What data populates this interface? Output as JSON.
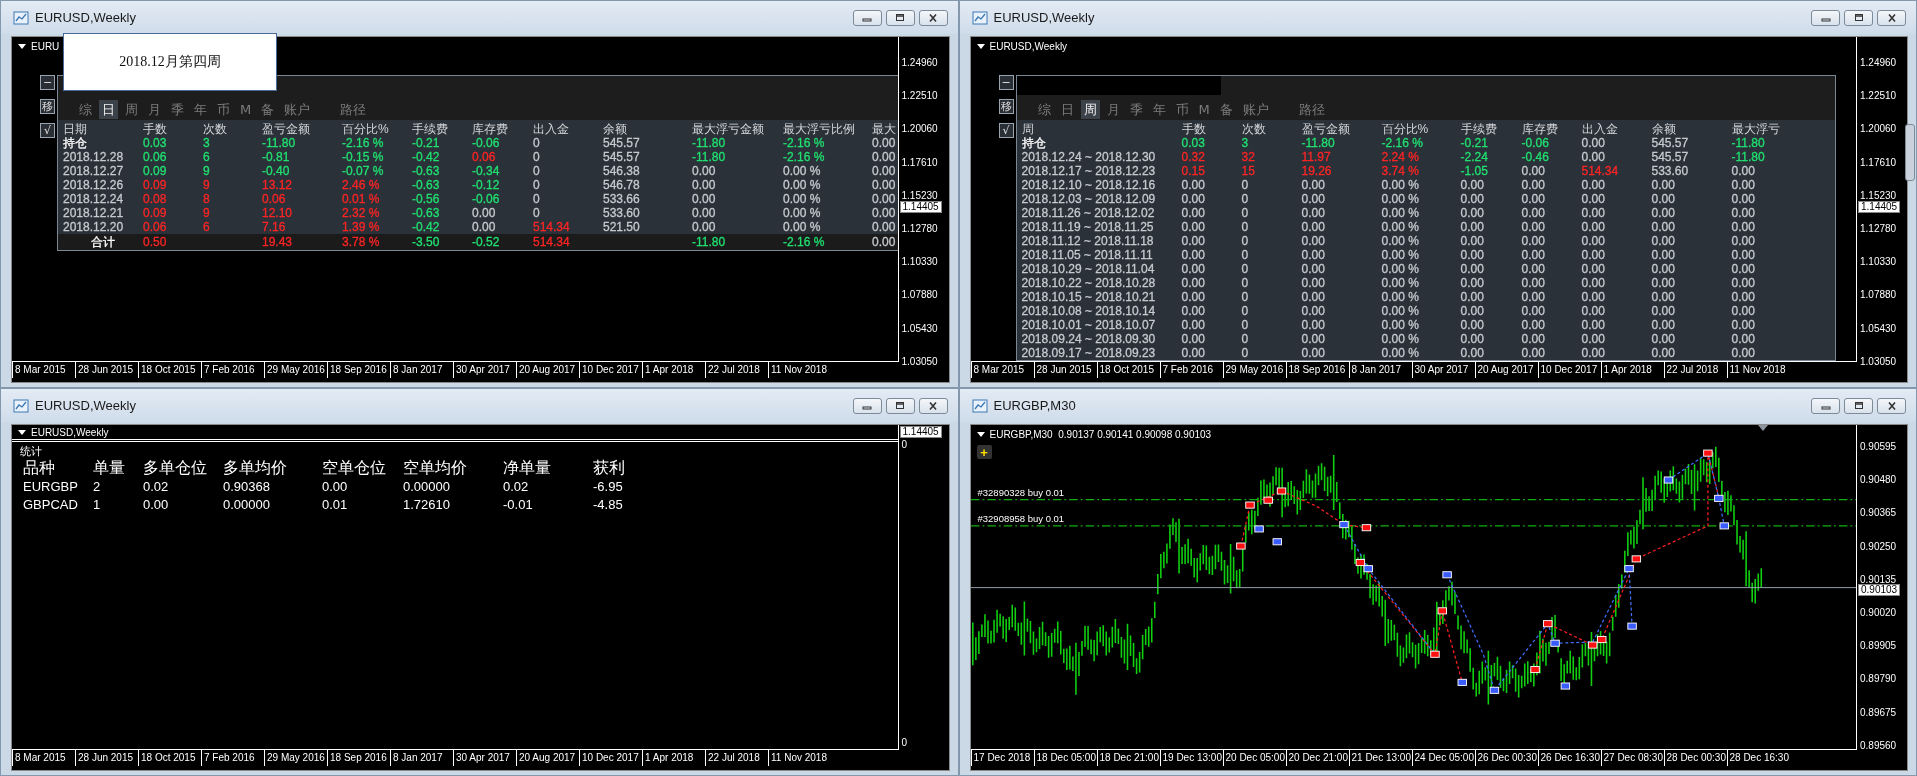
{
  "windows": [
    {
      "title": "EURUSD,Weekly",
      "popup": {
        "text": "2018.12月第四周"
      },
      "chart": {
        "header": "EURU",
        "price_axis": [
          "1.24960",
          "1.22510",
          "1.20060",
          "1.17610",
          "1.15230",
          "1.12780",
          "1.10330",
          "1.07880",
          "1.05430",
          "1.03050"
        ],
        "current_price": "1.14405",
        "time_axis": [
          "8 Mar 2015",
          "28 Jun 2015",
          "18 Oct 2015",
          "7 Feb 2016",
          "29 May 2016",
          "18 Sep 2016",
          "8 Jan 2017",
          "30 Apr 2017",
          "20 Aug 2017",
          "10 Dec 2017",
          "1 Apr 2018",
          "22 Jul 2018",
          "11 Nov 2018"
        ]
      },
      "panel": {
        "kind": "report",
        "redacted": false,
        "side_buttons": [
          "−",
          "移",
          "√"
        ],
        "tabs": [
          {
            "label": "综",
            "selected": false
          },
          {
            "label": "日",
            "selected": true
          },
          {
            "label": "周",
            "selected": false
          },
          {
            "label": "月",
            "selected": false
          },
          {
            "label": "季",
            "selected": false
          },
          {
            "label": "年",
            "selected": false
          },
          {
            "label": "币",
            "selected": false
          },
          {
            "label": "M",
            "selected": false
          },
          {
            "label": "备",
            "selected": false
          },
          {
            "label": "账户",
            "selected": false
          },
          {
            "label": "路径",
            "selected": false
          }
        ],
        "columns": [
          "日期",
          "手数",
          "次数",
          "盈亏金额",
          "百分比%",
          "手续费",
          "库存费",
          "出入金",
          "余额",
          "最大浮亏金额",
          "最大浮亏比例",
          "最大"
        ],
        "rows": [
          {
            "kind": "data",
            "cells": [
              {
                "text": "持仓",
                "color": "#ffffff"
              },
              {
                "text": "0.03",
                "color": "#20e070"
              },
              {
                "text": "3",
                "color": "#20e070"
              },
              {
                "text": "-11.80",
                "color": "#20e070"
              },
              {
                "text": "-2.16 %",
                "color": "#20e070"
              },
              {
                "text": "-0.21",
                "color": "#20e070"
              },
              {
                "text": "-0.06",
                "color": "#20e070"
              },
              {
                "text": "0",
                "color": "#c6cad0"
              },
              {
                "text": "545.57",
                "color": "#c6cad0"
              },
              {
                "text": "-11.80",
                "color": "#20e070"
              },
              {
                "text": "-2.16 %",
                "color": "#20e070"
              },
              {
                "text": "0.00",
                "color": "#c6cad0"
              }
            ]
          },
          {
            "kind": "data",
            "cells": [
              {
                "text": "2018.12.28",
                "color": "#c6cad0"
              },
              {
                "text": "0.06",
                "color": "#20e070"
              },
              {
                "text": "6",
                "color": "#20e070"
              },
              {
                "text": "-0.81",
                "color": "#20e070"
              },
              {
                "text": "-0.15 %",
                "color": "#20e070"
              },
              {
                "text": "-0.42",
                "color": "#20e070"
              },
              {
                "text": "0.06",
                "color": "#ff2424"
              },
              {
                "text": "0",
                "color": "#c6cad0"
              },
              {
                "text": "545.57",
                "color": "#c6cad0"
              },
              {
                "text": "-11.80",
                "color": "#20e070"
              },
              {
                "text": "-2.16 %",
                "color": "#20e070"
              },
              {
                "text": "0.00",
                "color": "#c6cad0"
              }
            ]
          },
          {
            "kind": "data",
            "cells": [
              {
                "text": "2018.12.27",
                "color": "#c6cad0"
              },
              {
                "text": "0.09",
                "color": "#20e070"
              },
              {
                "text": "9",
                "color": "#20e070"
              },
              {
                "text": "-0.40",
                "color": "#20e070"
              },
              {
                "text": "-0.07 %",
                "color": "#20e070"
              },
              {
                "text": "-0.63",
                "color": "#20e070"
              },
              {
                "text": "-0.34",
                "color": "#20e070"
              },
              {
                "text": "0",
                "color": "#c6cad0"
              },
              {
                "text": "546.38",
                "color": "#c6cad0"
              },
              {
                "text": "0.00",
                "color": "#c6cad0"
              },
              {
                "text": "0.00 %",
                "color": "#c6cad0"
              },
              {
                "text": "0.00",
                "color": "#c6cad0"
              }
            ]
          },
          {
            "kind": "data",
            "cells": [
              {
                "text": "2018.12.26",
                "color": "#c6cad0"
              },
              {
                "text": "0.09",
                "color": "#ff2424"
              },
              {
                "text": "9",
                "color": "#ff2424"
              },
              {
                "text": "13.12",
                "color": "#ff2424"
              },
              {
                "text": "2.46 %",
                "color": "#ff2424"
              },
              {
                "text": "-0.63",
                "color": "#20e070"
              },
              {
                "text": "-0.12",
                "color": "#20e070"
              },
              {
                "text": "0",
                "color": "#c6cad0"
              },
              {
                "text": "546.78",
                "color": "#c6cad0"
              },
              {
                "text": "0.00",
                "color": "#c6cad0"
              },
              {
                "text": "0.00 %",
                "color": "#c6cad0"
              },
              {
                "text": "0.00",
                "color": "#c6cad0"
              }
            ]
          },
          {
            "kind": "data",
            "cells": [
              {
                "text": "2018.12.24",
                "color": "#c6cad0"
              },
              {
                "text": "0.08",
                "color": "#ff2424"
              },
              {
                "text": "8",
                "color": "#ff2424"
              },
              {
                "text": "0.06",
                "color": "#ff2424"
              },
              {
                "text": "0.01 %",
                "color": "#ff2424"
              },
              {
                "text": "-0.56",
                "color": "#20e070"
              },
              {
                "text": "-0.06",
                "color": "#20e070"
              },
              {
                "text": "0",
                "color": "#c6cad0"
              },
              {
                "text": "533.66",
                "color": "#c6cad0"
              },
              {
                "text": "0.00",
                "color": "#c6cad0"
              },
              {
                "text": "0.00 %",
                "color": "#c6cad0"
              },
              {
                "text": "0.00",
                "color": "#c6cad0"
              }
            ]
          },
          {
            "kind": "data",
            "cells": [
              {
                "text": "2018.12.21",
                "color": "#c6cad0"
              },
              {
                "text": "0.09",
                "color": "#ff2424"
              },
              {
                "text": "9",
                "color": "#ff2424"
              },
              {
                "text": "12.10",
                "color": "#ff2424"
              },
              {
                "text": "2.32 %",
                "color": "#ff2424"
              },
              {
                "text": "-0.63",
                "color": "#20e070"
              },
              {
                "text": "0.00",
                "color": "#c6cad0"
              },
              {
                "text": "0",
                "color": "#c6cad0"
              },
              {
                "text": "533.60",
                "color": "#c6cad0"
              },
              {
                "text": "0.00",
                "color": "#c6cad0"
              },
              {
                "text": "0.00 %",
                "color": "#c6cad0"
              },
              {
                "text": "0.00",
                "color": "#c6cad0"
              }
            ]
          },
          {
            "kind": "data",
            "cells": [
              {
                "text": "2018.12.20",
                "color": "#c6cad0"
              },
              {
                "text": "0.06",
                "color": "#ff2424"
              },
              {
                "text": "6",
                "color": "#ff2424"
              },
              {
                "text": "7.16",
                "color": "#ff2424"
              },
              {
                "text": "1.39 %",
                "color": "#ff2424"
              },
              {
                "text": "-0.42",
                "color": "#20e070"
              },
              {
                "text": "0.00",
                "color": "#c6cad0"
              },
              {
                "text": "514.34",
                "color": "#ff2424"
              },
              {
                "text": "521.50",
                "color": "#c6cad0"
              },
              {
                "text": "0.00",
                "color": "#c6cad0"
              },
              {
                "text": "0.00 %",
                "color": "#c6cad0"
              },
              {
                "text": "0.00",
                "color": "#c6cad0"
              }
            ]
          },
          {
            "kind": "total",
            "cells": [
              {
                "text": "合计",
                "color": "#ffffff"
              },
              {
                "text": "0.50",
                "color": "#ff2424"
              },
              null,
              {
                "text": "19.43",
                "color": "#ff2424"
              },
              {
                "text": "3.78 %",
                "color": "#ff2424"
              },
              {
                "text": "-3.50",
                "color": "#20e070"
              },
              {
                "text": "-0.52",
                "color": "#20e070"
              },
              {
                "text": "514.34",
                "color": "#ff2424"
              },
              null,
              {
                "text": "-11.80",
                "color": "#20e070"
              },
              {
                "text": "-2.16 %",
                "color": "#20e070"
              },
              {
                "text": "0.00",
                "color": "#c6cad0"
              }
            ]
          }
        ]
      }
    },
    {
      "title": "EURUSD,Weekly",
      "chart": {
        "header": "EURUSD,Weekly",
        "price_axis": [
          "1.24960",
          "1.22510",
          "1.20060",
          "1.17610",
          "1.15230",
          "1.12780",
          "1.10330",
          "1.07880",
          "1.05430",
          "1.03050"
        ],
        "current_price": "1.14405",
        "time_axis": [
          "8 Mar 2015",
          "28 Jun 2015",
          "18 Oct 2015",
          "7 Feb 2016",
          "29 May 2016",
          "18 Sep 2016",
          "8 Jan 2017",
          "30 Apr 2017",
          "20 Aug 2017",
          "10 Dec 2017",
          "1 Apr 2018",
          "22 Jul 2018",
          "11 Nov 2018"
        ]
      },
      "panel": {
        "kind": "report",
        "redacted": true,
        "side_buttons": [
          "−",
          "移",
          "√"
        ],
        "tabs": [
          {
            "label": "综",
            "selected": false
          },
          {
            "label": "日",
            "selected": false
          },
          {
            "label": "周",
            "selected": true
          },
          {
            "label": "月",
            "selected": false
          },
          {
            "label": "季",
            "selected": false
          },
          {
            "label": "年",
            "selected": false
          },
          {
            "label": "币",
            "selected": false
          },
          {
            "label": "M",
            "selected": false
          },
          {
            "label": "备",
            "selected": false
          },
          {
            "label": "账户",
            "selected": false
          },
          {
            "label": "路径",
            "selected": false
          }
        ],
        "columns": [
          "周",
          "手数",
          "次数",
          "盈亏金额",
          "百分比%",
          "手续费",
          "库存费",
          "出入金",
          "余额",
          "最大浮亏"
        ],
        "rows": [
          {
            "kind": "data",
            "cells": [
              {
                "text": "持仓",
                "color": "#ffffff"
              },
              {
                "text": "0.03",
                "color": "#20e070"
              },
              {
                "text": "3",
                "color": "#20e070"
              },
              {
                "text": "-11.80",
                "color": "#20e070"
              },
              {
                "text": "-2.16 %",
                "color": "#20e070"
              },
              {
                "text": "-0.21",
                "color": "#20e070"
              },
              {
                "text": "-0.06",
                "color": "#20e070"
              },
              {
                "text": "0.00",
                "color": "#c6cad0"
              },
              {
                "text": "545.57",
                "color": "#c6cad0"
              },
              {
                "text": "-11.80",
                "color": "#20e070"
              }
            ]
          },
          {
            "kind": "data",
            "cells": [
              {
                "text": "2018.12.24 ~ 2018.12.30",
                "color": "#c6cad0"
              },
              {
                "text": "0.32",
                "color": "#ff2424"
              },
              {
                "text": "32",
                "color": "#ff2424"
              },
              {
                "text": "11.97",
                "color": "#ff2424"
              },
              {
                "text": "2.24 %",
                "color": "#ff2424"
              },
              {
                "text": "-2.24",
                "color": "#20e070"
              },
              {
                "text": "-0.46",
                "color": "#20e070"
              },
              {
                "text": "0.00",
                "color": "#c6cad0"
              },
              {
                "text": "545.57",
                "color": "#c6cad0"
              },
              {
                "text": "-11.80",
                "color": "#20e070"
              }
            ]
          },
          {
            "kind": "data",
            "cells": [
              {
                "text": "2018.12.17 ~ 2018.12.23",
                "color": "#c6cad0"
              },
              {
                "text": "0.15",
                "color": "#ff2424"
              },
              {
                "text": "15",
                "color": "#ff2424"
              },
              {
                "text": "19.26",
                "color": "#ff2424"
              },
              {
                "text": "3.74 %",
                "color": "#ff2424"
              },
              {
                "text": "-1.05",
                "color": "#20e070"
              },
              {
                "text": "0.00",
                "color": "#c6cad0"
              },
              {
                "text": "514.34",
                "color": "#ff2424"
              },
              {
                "text": "533.60",
                "color": "#c6cad0"
              },
              {
                "text": "0.00",
                "color": "#c6cad0"
              }
            ]
          },
          {
            "kind": "data",
            "cells": [
              {
                "text": "2018.12.10 ~ 2018.12.16",
                "color": "#c6cad0"
              },
              {
                "text": "0.00",
                "color": "#c6cad0"
              },
              {
                "text": "0",
                "color": "#c6cad0"
              },
              {
                "text": "0.00",
                "color": "#c6cad0"
              },
              {
                "text": "0.00 %",
                "color": "#c6cad0"
              },
              {
                "text": "0.00",
                "color": "#c6cad0"
              },
              {
                "text": "0.00",
                "color": "#c6cad0"
              },
              {
                "text": "0.00",
                "color": "#c6cad0"
              },
              {
                "text": "0.00",
                "color": "#c6cad0"
              },
              {
                "text": "0.00",
                "color": "#c6cad0"
              }
            ]
          },
          {
            "kind": "data",
            "cells": [
              {
                "text": "2018.12.03 ~ 2018.12.09",
                "color": "#c6cad0"
              },
              {
                "text": "0.00",
                "color": "#c6cad0"
              },
              {
                "text": "0",
                "color": "#c6cad0"
              },
              {
                "text": "0.00",
                "color": "#c6cad0"
              },
              {
                "text": "0.00 %",
                "color": "#c6cad0"
              },
              {
                "text": "0.00",
                "color": "#c6cad0"
              },
              {
                "text": "0.00",
                "color": "#c6cad0"
              },
              {
                "text": "0.00",
                "color": "#c6cad0"
              },
              {
                "text": "0.00",
                "color": "#c6cad0"
              },
              {
                "text": "0.00",
                "color": "#c6cad0"
              }
            ]
          },
          {
            "kind": "data",
            "cells": [
              {
                "text": "2018.11.26 ~ 2018.12.02",
                "color": "#c6cad0"
              },
              {
                "text": "0.00",
                "color": "#c6cad0"
              },
              {
                "text": "0",
                "color": "#c6cad0"
              },
              {
                "text": "0.00",
                "color": "#c6cad0"
              },
              {
                "text": "0.00 %",
                "color": "#c6cad0"
              },
              {
                "text": "0.00",
                "color": "#c6cad0"
              },
              {
                "text": "0.00",
                "color": "#c6cad0"
              },
              {
                "text": "0.00",
                "color": "#c6cad0"
              },
              {
                "text": "0.00",
                "color": "#c6cad0"
              },
              {
                "text": "0.00",
                "color": "#c6cad0"
              }
            ]
          },
          {
            "kind": "data",
            "cells": [
              {
                "text": "2018.11.19 ~ 2018.11.25",
                "color": "#c6cad0"
              },
              {
                "text": "0.00",
                "color": "#c6cad0"
              },
              {
                "text": "0",
                "color": "#c6cad0"
              },
              {
                "text": "0.00",
                "color": "#c6cad0"
              },
              {
                "text": "0.00 %",
                "color": "#c6cad0"
              },
              {
                "text": "0.00",
                "color": "#c6cad0"
              },
              {
                "text": "0.00",
                "color": "#c6cad0"
              },
              {
                "text": "0.00",
                "color": "#c6cad0"
              },
              {
                "text": "0.00",
                "color": "#c6cad0"
              },
              {
                "text": "0.00",
                "color": "#c6cad0"
              }
            ]
          },
          {
            "kind": "data",
            "cells": [
              {
                "text": "2018.11.12 ~ 2018.11.18",
                "color": "#c6cad0"
              },
              {
                "text": "0.00",
                "color": "#c6cad0"
              },
              {
                "text": "0",
                "color": "#c6cad0"
              },
              {
                "text": "0.00",
                "color": "#c6cad0"
              },
              {
                "text": "0.00 %",
                "color": "#c6cad0"
              },
              {
                "text": "0.00",
                "color": "#c6cad0"
              },
              {
                "text": "0.00",
                "color": "#c6cad0"
              },
              {
                "text": "0.00",
                "color": "#c6cad0"
              },
              {
                "text": "0.00",
                "color": "#c6cad0"
              },
              {
                "text": "0.00",
                "color": "#c6cad0"
              }
            ]
          },
          {
            "kind": "data",
            "cells": [
              {
                "text": "2018.11.05 ~ 2018.11.11",
                "color": "#c6cad0"
              },
              {
                "text": "0.00",
                "color": "#c6cad0"
              },
              {
                "text": "0",
                "color": "#c6cad0"
              },
              {
                "text": "0.00",
                "color": "#c6cad0"
              },
              {
                "text": "0.00 %",
                "color": "#c6cad0"
              },
              {
                "text": "0.00",
                "color": "#c6cad0"
              },
              {
                "text": "0.00",
                "color": "#c6cad0"
              },
              {
                "text": "0.00",
                "color": "#c6cad0"
              },
              {
                "text": "0.00",
                "color": "#c6cad0"
              },
              {
                "text": "0.00",
                "color": "#c6cad0"
              }
            ]
          },
          {
            "kind": "data",
            "cells": [
              {
                "text": "2018.10.29 ~ 2018.11.04",
                "color": "#c6cad0"
              },
              {
                "text": "0.00",
                "color": "#c6cad0"
              },
              {
                "text": "0",
                "color": "#c6cad0"
              },
              {
                "text": "0.00",
                "color": "#c6cad0"
              },
              {
                "text": "0.00 %",
                "color": "#c6cad0"
              },
              {
                "text": "0.00",
                "color": "#c6cad0"
              },
              {
                "text": "0.00",
                "color": "#c6cad0"
              },
              {
                "text": "0.00",
                "color": "#c6cad0"
              },
              {
                "text": "0.00",
                "color": "#c6cad0"
              },
              {
                "text": "0.00",
                "color": "#c6cad0"
              }
            ]
          },
          {
            "kind": "data",
            "cells": [
              {
                "text": "2018.10.22 ~ 2018.10.28",
                "color": "#c6cad0"
              },
              {
                "text": "0.00",
                "color": "#c6cad0"
              },
              {
                "text": "0",
                "color": "#c6cad0"
              },
              {
                "text": "0.00",
                "color": "#c6cad0"
              },
              {
                "text": "0.00 %",
                "color": "#c6cad0"
              },
              {
                "text": "0.00",
                "color": "#c6cad0"
              },
              {
                "text": "0.00",
                "color": "#c6cad0"
              },
              {
                "text": "0.00",
                "color": "#c6cad0"
              },
              {
                "text": "0.00",
                "color": "#c6cad0"
              },
              {
                "text": "0.00",
                "color": "#c6cad0"
              }
            ]
          },
          {
            "kind": "data",
            "cells": [
              {
                "text": "2018.10.15 ~ 2018.10.21",
                "color": "#c6cad0"
              },
              {
                "text": "0.00",
                "color": "#c6cad0"
              },
              {
                "text": "0",
                "color": "#c6cad0"
              },
              {
                "text": "0.00",
                "color": "#c6cad0"
              },
              {
                "text": "0.00 %",
                "color": "#c6cad0"
              },
              {
                "text": "0.00",
                "color": "#c6cad0"
              },
              {
                "text": "0.00",
                "color": "#c6cad0"
              },
              {
                "text": "0.00",
                "color": "#c6cad0"
              },
              {
                "text": "0.00",
                "color": "#c6cad0"
              },
              {
                "text": "0.00",
                "color": "#c6cad0"
              }
            ]
          },
          {
            "kind": "data",
            "cells": [
              {
                "text": "2018.10.08 ~ 2018.10.14",
                "color": "#c6cad0"
              },
              {
                "text": "0.00",
                "color": "#c6cad0"
              },
              {
                "text": "0",
                "color": "#c6cad0"
              },
              {
                "text": "0.00",
                "color": "#c6cad0"
              },
              {
                "text": "0.00 %",
                "color": "#c6cad0"
              },
              {
                "text": "0.00",
                "color": "#c6cad0"
              },
              {
                "text": "0.00",
                "color": "#c6cad0"
              },
              {
                "text": "0.00",
                "color": "#c6cad0"
              },
              {
                "text": "0.00",
                "color": "#c6cad0"
              },
              {
                "text": "0.00",
                "color": "#c6cad0"
              }
            ]
          },
          {
            "kind": "data",
            "cells": [
              {
                "text": "2018.10.01 ~ 2018.10.07",
                "color": "#c6cad0"
              },
              {
                "text": "0.00",
                "color": "#c6cad0"
              },
              {
                "text": "0",
                "color": "#c6cad0"
              },
              {
                "text": "0.00",
                "color": "#c6cad0"
              },
              {
                "text": "0.00 %",
                "color": "#c6cad0"
              },
              {
                "text": "0.00",
                "color": "#c6cad0"
              },
              {
                "text": "0.00",
                "color": "#c6cad0"
              },
              {
                "text": "0.00",
                "color": "#c6cad0"
              },
              {
                "text": "0.00",
                "color": "#c6cad0"
              },
              {
                "text": "0.00",
                "color": "#c6cad0"
              }
            ]
          },
          {
            "kind": "data",
            "cells": [
              {
                "text": "2018.09.24 ~ 2018.09.30",
                "color": "#c6cad0"
              },
              {
                "text": "0.00",
                "color": "#c6cad0"
              },
              {
                "text": "0",
                "color": "#c6cad0"
              },
              {
                "text": "0.00",
                "color": "#c6cad0"
              },
              {
                "text": "0.00 %",
                "color": "#c6cad0"
              },
              {
                "text": "0.00",
                "color": "#c6cad0"
              },
              {
                "text": "0.00",
                "color": "#c6cad0"
              },
              {
                "text": "0.00",
                "color": "#c6cad0"
              },
              {
                "text": "0.00",
                "color": "#c6cad0"
              },
              {
                "text": "0.00",
                "color": "#c6cad0"
              }
            ]
          },
          {
            "kind": "data",
            "cells": [
              {
                "text": "2018.09.17 ~ 2018.09.23",
                "color": "#c6cad0"
              },
              {
                "text": "0.00",
                "color": "#c6cad0"
              },
              {
                "text": "0",
                "color": "#c6cad0"
              },
              {
                "text": "0.00",
                "color": "#c6cad0"
              },
              {
                "text": "0.00 %",
                "color": "#c6cad0"
              },
              {
                "text": "0.00",
                "color": "#c6cad0"
              },
              {
                "text": "0.00",
                "color": "#c6cad0"
              },
              {
                "text": "0.00",
                "color": "#c6cad0"
              },
              {
                "text": "0.00",
                "color": "#c6cad0"
              },
              {
                "text": "0.00",
                "color": "#c6cad0"
              }
            ]
          }
        ]
      }
    },
    {
      "title": "EURUSD,Weekly",
      "chart": {
        "header": "EURUSD,Weekly",
        "current_price": "1.14405",
        "time_axis": [
          "8 Mar 2015",
          "28 Jun 2015",
          "18 Oct 2015",
          "7 Feb 2016",
          "29 May 2016",
          "18 Sep 2016",
          "8 Jan 2017",
          "30 Apr 2017",
          "20 Aug 2017",
          "10 Dec 2017",
          "1 Apr 2018",
          "22 Jul 2018",
          "11 Nov 2018"
        ]
      },
      "panel": {
        "kind": "summary",
        "label": "统计",
        "axis": [
          "0",
          "0"
        ],
        "columns": [
          "品种",
          "单量",
          "多单仓位",
          "多单均价",
          "空单仓位",
          "空单均价",
          "净单量",
          "获利"
        ],
        "rows": [
          [
            "EURGBP",
            "2",
            "0.02",
            "0.90368",
            "0.00",
            "0.00000",
            "0.02",
            "-6.95"
          ],
          [
            "GBPCAD",
            "1",
            "0.00",
            "0.00000",
            "0.01",
            "1.72610",
            "-0.01",
            "-4.85"
          ]
        ]
      }
    },
    {
      "title": "EURGBP,M30",
      "chart": {
        "header": "EURGBP,M30  0.90137 0.90141 0.90098 0.90103",
        "price_axis": [
          "0.90595",
          "0.90480",
          "0.90365",
          "0.90250",
          "0.90135",
          "0.90020",
          "0.89905",
          "0.89790",
          "0.89675",
          "0.89560"
        ],
        "current_price": "0.90103",
        "time_axis": [
          "17 Dec 2018",
          "18 Dec 05:00",
          "18 Dec 21:00",
          "19 Dec 13:00",
          "20 Dec 05:00",
          "20 Dec 21:00",
          "21 Dec 13:00",
          "24 Dec 05:00",
          "26 Dec 00:30",
          "26 Dec 16:30",
          "27 Dec 08:30",
          "28 Dec 00:30",
          "28 Dec 16:30"
        ]
      },
      "panel": {
        "kind": "bars",
        "button": "+",
        "orders": [
          {
            "label": "#32890328 buy 0.01"
          },
          {
            "label": "#32908958 buy 0.01"
          }
        ]
      }
    }
  ]
}
